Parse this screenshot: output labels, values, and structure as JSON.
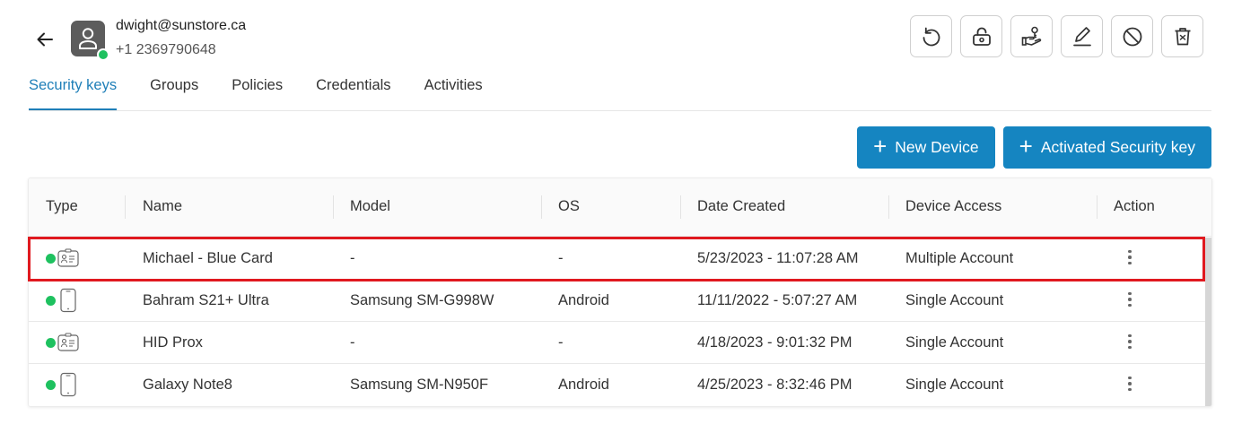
{
  "user": {
    "email": "dwight@sunstore.ca",
    "phone": "+1 2369790648"
  },
  "toolbar": {
    "icons": [
      "reset-icon",
      "unlock-icon",
      "hand-key-icon",
      "edit-icon",
      "block-icon",
      "delete-icon"
    ]
  },
  "tabs": [
    {
      "label": "Security keys",
      "active": true
    },
    {
      "label": "Groups",
      "active": false
    },
    {
      "label": "Policies",
      "active": false
    },
    {
      "label": "Credentials",
      "active": false
    },
    {
      "label": "Activities",
      "active": false
    }
  ],
  "actions": {
    "new_device": "New Device",
    "activated_key": "Activated Security key"
  },
  "table": {
    "columns": [
      "Type",
      "Name",
      "Model",
      "OS",
      "Date Created",
      "Device Access",
      "Action"
    ],
    "rows": [
      {
        "type": "card",
        "status": "online",
        "name": "Michael - Blue Card",
        "model": "-",
        "os": "-",
        "date": "5/23/2023 - 11:07:28 AM",
        "access": "Multiple Account"
      },
      {
        "type": "phone",
        "status": "online",
        "name": "Bahram S21+ Ultra",
        "model": "Samsung SM-G998W",
        "os": "Android",
        "date": "11/11/2022 - 5:07:27 AM",
        "access": "Single Account"
      },
      {
        "type": "card",
        "status": "online",
        "name": "HID Prox",
        "model": "-",
        "os": "-",
        "date": "4/18/2023 - 9:01:32 PM",
        "access": "Single Account"
      },
      {
        "type": "phone",
        "status": "online",
        "name": "Galaxy Note8",
        "model": "Samsung SM-N950F",
        "os": "Android",
        "date": "4/25/2023 - 8:32:46 PM",
        "access": "Single Account"
      }
    ]
  },
  "colors": {
    "accent": "#1585c1",
    "tab_active": "#1f7fb8",
    "online": "#1ec15f",
    "highlight": "#e0191f"
  }
}
